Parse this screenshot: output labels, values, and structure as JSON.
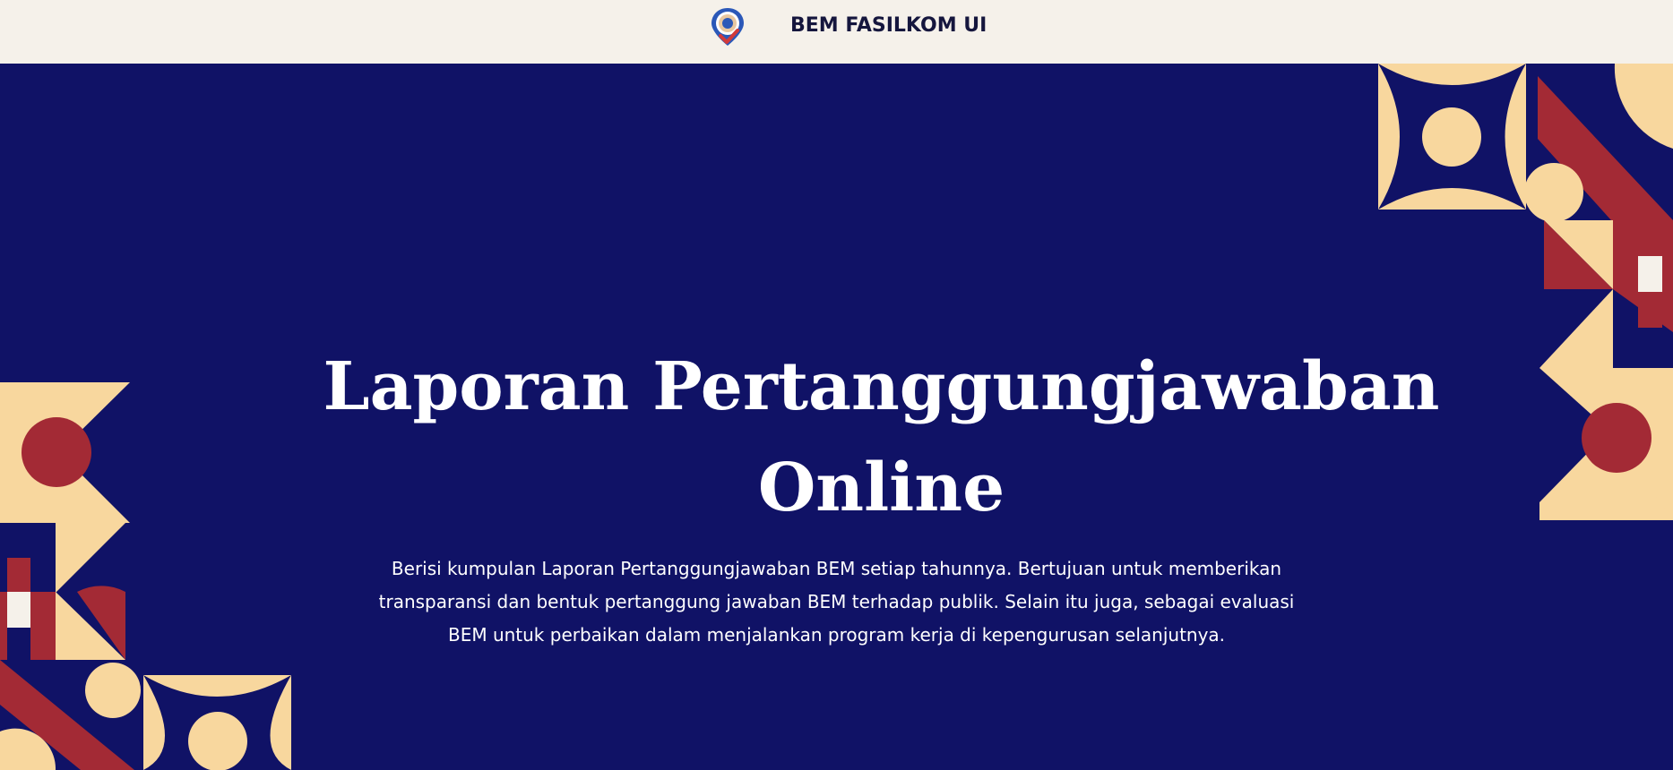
{
  "header": {
    "brand_name": "BEM FASILKOM UI",
    "logo_icon": "bem-fasilkom-logo-icon"
  },
  "hero": {
    "title": "Laporan Pertanggungjawaban Online",
    "description": "Berisi kumpulan Laporan Pertanggungjawaban BEM setiap tahunnya. Bertujuan untuk memberikan transparansi dan bentuk pertanggung jawaban BEM terhadap publik. Selain itu juga, sebagai evaluasi BEM untuk perbaikan dalam menjalankan program kerja di kepengurusan selanjutnya."
  },
  "colors": {
    "navy": "#101266",
    "cream": "#f8d79e",
    "red": "#a32a35",
    "offwhite": "#f5f1ea",
    "text_dark": "#15163d"
  }
}
